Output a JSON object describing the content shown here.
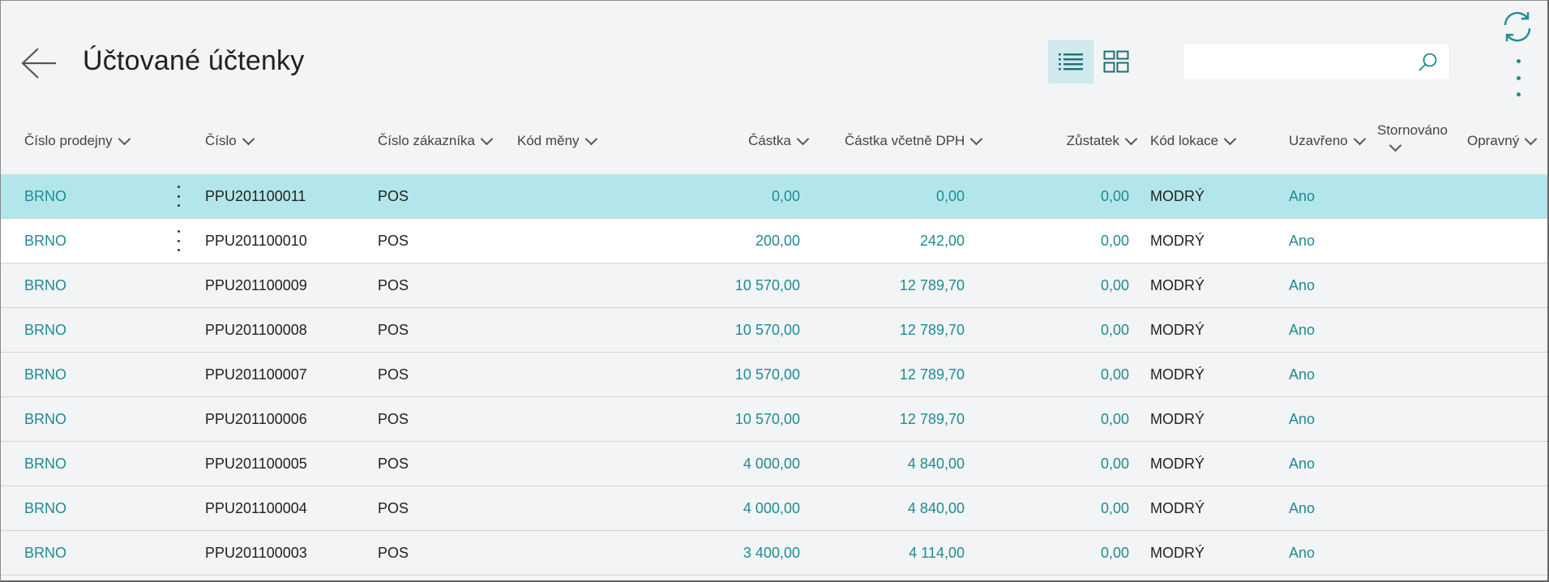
{
  "page": {
    "title": "Účtované účtenky",
    "search_value": "",
    "search_placeholder": ""
  },
  "icons": {
    "back": "arrow-left-icon",
    "list_view": "list-view-icon",
    "tile_view": "tile-view-icon",
    "search": "search-icon",
    "refresh": "refresh-icon",
    "more": "more-vertical-icon"
  },
  "colors": {
    "accent": "#1e8b93",
    "selected_row": "#b3e6ea",
    "background": "#f3f4f5"
  },
  "columns": [
    "Číslo prodejny",
    "Číslo",
    "Číslo zákazníka",
    "Kód měny",
    "Částka",
    "Částka včetně DPH",
    "Zůstatek",
    "Kód lokace",
    "Uzavřeno",
    "Stornováno",
    "Opravný"
  ],
  "rows": [
    {
      "store": "BRNO",
      "number": "PPU201100011",
      "customer": "POS",
      "currency": "",
      "amount": "0,00",
      "amount_vat": "0,00",
      "balance": "0,00",
      "location": "MODRÝ",
      "closed": "Ano",
      "cancelled": "",
      "corrective": ""
    },
    {
      "store": "BRNO",
      "number": "PPU201100010",
      "customer": "POS",
      "currency": "",
      "amount": "200,00",
      "amount_vat": "242,00",
      "balance": "0,00",
      "location": "MODRÝ",
      "closed": "Ano",
      "cancelled": "",
      "corrective": ""
    },
    {
      "store": "BRNO",
      "number": "PPU201100009",
      "customer": "POS",
      "currency": "",
      "amount": "10 570,00",
      "amount_vat": "12 789,70",
      "balance": "0,00",
      "location": "MODRÝ",
      "closed": "Ano",
      "cancelled": "",
      "corrective": ""
    },
    {
      "store": "BRNO",
      "number": "PPU201100008",
      "customer": "POS",
      "currency": "",
      "amount": "10 570,00",
      "amount_vat": "12 789,70",
      "balance": "0,00",
      "location": "MODRÝ",
      "closed": "Ano",
      "cancelled": "",
      "corrective": ""
    },
    {
      "store": "BRNO",
      "number": "PPU201100007",
      "customer": "POS",
      "currency": "",
      "amount": "10 570,00",
      "amount_vat": "12 789,70",
      "balance": "0,00",
      "location": "MODRÝ",
      "closed": "Ano",
      "cancelled": "",
      "corrective": ""
    },
    {
      "store": "BRNO",
      "number": "PPU201100006",
      "customer": "POS",
      "currency": "",
      "amount": "10 570,00",
      "amount_vat": "12 789,70",
      "balance": "0,00",
      "location": "MODRÝ",
      "closed": "Ano",
      "cancelled": "",
      "corrective": ""
    },
    {
      "store": "BRNO",
      "number": "PPU201100005",
      "customer": "POS",
      "currency": "",
      "amount": "4 000,00",
      "amount_vat": "4 840,00",
      "balance": "0,00",
      "location": "MODRÝ",
      "closed": "Ano",
      "cancelled": "",
      "corrective": ""
    },
    {
      "store": "BRNO",
      "number": "PPU201100004",
      "customer": "POS",
      "currency": "",
      "amount": "4 000,00",
      "amount_vat": "4 840,00",
      "balance": "0,00",
      "location": "MODRÝ",
      "closed": "Ano",
      "cancelled": "",
      "corrective": ""
    },
    {
      "store": "BRNO",
      "number": "PPU201100003",
      "customer": "POS",
      "currency": "",
      "amount": "3 400,00",
      "amount_vat": "4 114,00",
      "balance": "0,00",
      "location": "MODRÝ",
      "closed": "Ano",
      "cancelled": "",
      "corrective": ""
    }
  ]
}
